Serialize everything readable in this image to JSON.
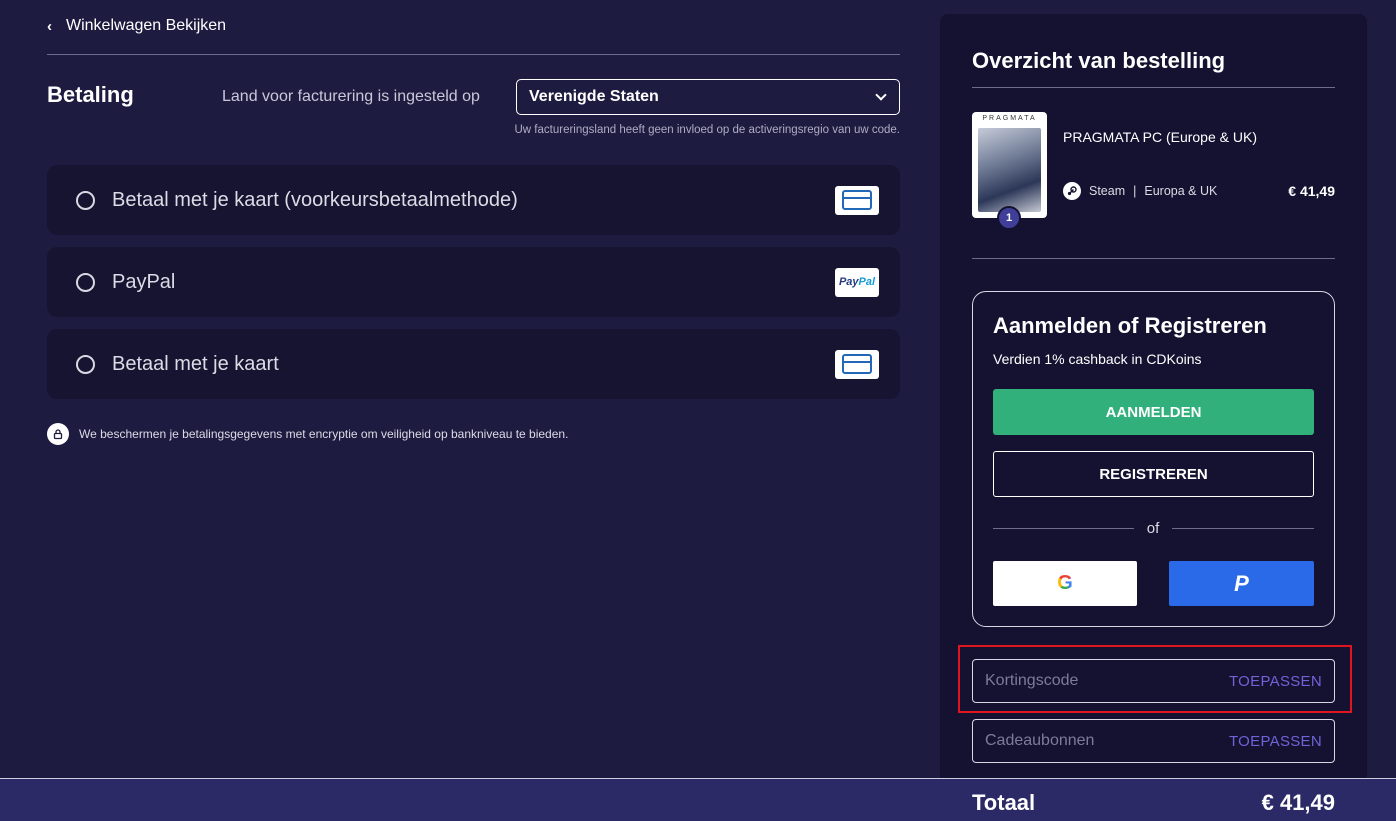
{
  "nav": {
    "back_label": "Winkelwagen Bekijken"
  },
  "payment": {
    "title": "Betaling",
    "country_label": "Land voor facturering is ingesteld op",
    "country_value": "Verenigde Staten",
    "country_note": "Uw factureringsland heeft geen invloed op de activeringsregio van uw code.",
    "methods": [
      {
        "label": "Betaal met je kaart (voorkeursbetaalmethode)",
        "icon": "credit-card-icon"
      },
      {
        "label": "PayPal",
        "icon": "paypal-logo"
      },
      {
        "label": "Betaal met je kaart",
        "icon": "credit-card-icon"
      }
    ],
    "paypal_badge_a": "Pay",
    "paypal_badge_b": "Pal",
    "security_note": "We beschermen je betalingsgegevens met encryptie om veiligheid op bankniveau te bieden."
  },
  "summary": {
    "title": "Overzicht van bestelling",
    "product": {
      "thumb_title": "PRAGMATA",
      "name": "PRAGMATA PC (Europe & UK)",
      "platform": "Steam",
      "separator": "|",
      "region": "Europa & UK",
      "price": "€ 41,49",
      "quantity": "1"
    }
  },
  "auth": {
    "title": "Aanmelden of Registreren",
    "subtitle": "Verdien 1% cashback in CDKoins",
    "login_label": "AANMELDEN",
    "register_label": "REGISTREREN",
    "or_label": "of",
    "google_letter": "G",
    "paypal_letter": "P"
  },
  "codes": {
    "discount_placeholder": "Kortingscode",
    "discount_apply": "TOEPASSEN",
    "gift_placeholder": "Cadeaubonnen",
    "gift_apply": "TOEPASSEN"
  },
  "total": {
    "label": "Totaal",
    "value": "€ 41,49"
  },
  "colors": {
    "background": "#1e1b40",
    "panel": "#141230",
    "accent_green": "#31b07c",
    "paypal_blue": "#2a6ae9",
    "apply_purple": "#6f63d8",
    "highlight_red": "#e0161e"
  }
}
